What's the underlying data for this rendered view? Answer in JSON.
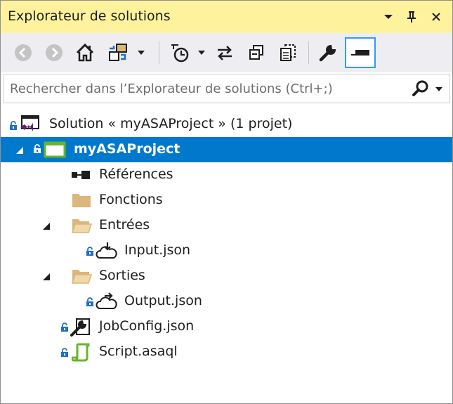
{
  "window": {
    "title": "Explorateur de solutions"
  },
  "search": {
    "placeholder": "Rechercher dans l’Explorateur de solutions (Ctrl+;)"
  },
  "tree": {
    "solution": "Solution « myASAProject » (1 projet)",
    "project": "myASAProject",
    "references": "Références",
    "functions": "Fonctions",
    "inputs": "Entrées",
    "input_file": "Input.json",
    "outputs": "Sorties",
    "output_file": "Output.json",
    "jobconfig": "JobConfig.json",
    "script": "Script.asaql"
  },
  "colors": {
    "title_bar": "#fff29d",
    "toolbar": "#eeeef2",
    "selection": "#0079cc",
    "folder": "#dcb67a",
    "lock": "#1e6fc9",
    "script_green": "#6ab42d",
    "vs_purple": "#68217a"
  }
}
